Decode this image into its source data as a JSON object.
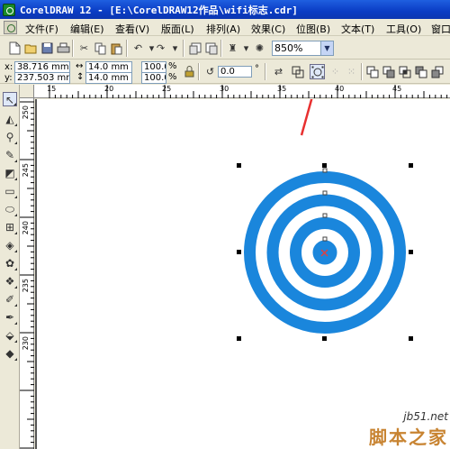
{
  "window": {
    "title": "CorelDRAW 12 - [E:\\CorelDRAW12作品\\wifi标志.cdr]"
  },
  "menubar": {
    "items": [
      "文件(F)",
      "编辑(E)",
      "查看(V)",
      "版面(L)",
      "排列(A)",
      "效果(C)",
      "位图(B)",
      "文本(T)",
      "工具(O)",
      "窗口"
    ]
  },
  "toolbar": {
    "zoom": "850%"
  },
  "property_bar": {
    "x": "38.716 mm",
    "y": "237.503 mm",
    "width": "14.0 mm",
    "height": "14.0 mm",
    "scale_x": "100.0",
    "scale_y": "100.0",
    "percent": "%",
    "angle": "0.0",
    "degree": "°",
    "x_label": "x:",
    "y_label": "y:"
  },
  "rulers": {
    "horizontal": [
      "15",
      "20",
      "25",
      "30",
      "35",
      "40",
      "45"
    ],
    "vertical": [
      "250",
      "245",
      "240",
      "235",
      "230"
    ]
  },
  "drawing": {
    "ring_color": "#1a86dc",
    "ring_count": 4
  },
  "watermark": {
    "site": "jb51.net",
    "text": "脚本之家"
  }
}
